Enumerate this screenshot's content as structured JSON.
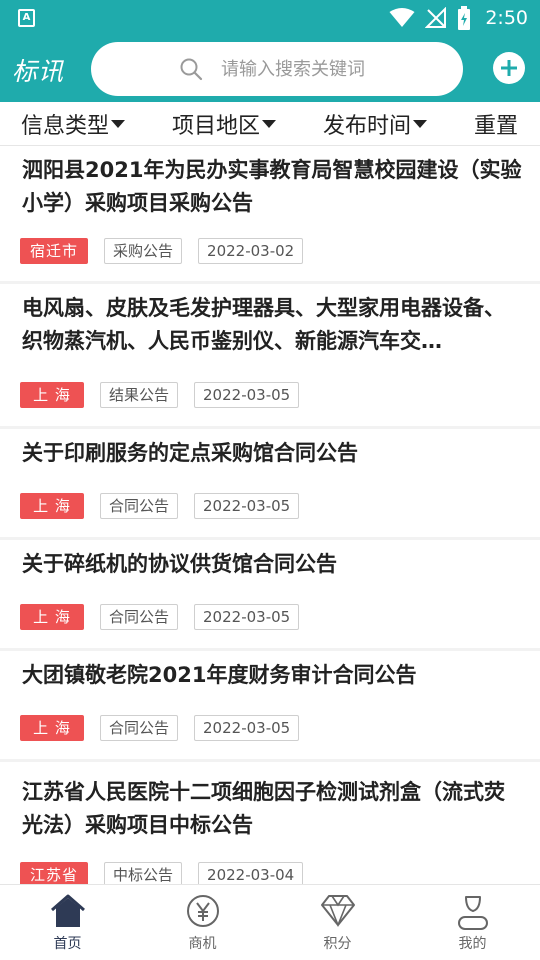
{
  "status_bar": {
    "time": "2:50",
    "app_indicator": "A"
  },
  "header": {
    "logo": "标讯",
    "search_placeholder": "请输入搜索关键词",
    "add_icon": "plus-icon"
  },
  "filters": [
    {
      "label": "信息类型",
      "has_caret": true
    },
    {
      "label": "项目地区",
      "has_caret": true
    },
    {
      "label": "发布时间",
      "has_caret": true
    },
    {
      "label": "重置",
      "has_caret": false
    }
  ],
  "items": [
    {
      "title": "泗阳县2021年为民办实事教育局智慧校园建设（实验小学）采购项目采购公告",
      "region": "宿迁市",
      "type": "采购公告",
      "date": "2022-03-02"
    },
    {
      "title": "电风扇、皮肤及毛发护理器具、大型家用电器设备、织物蒸汽机、人民币鉴别仪、新能源汽车交…",
      "region": "上 海",
      "type": "结果公告",
      "date": "2022-03-05"
    },
    {
      "title": "关于印刷服务的定点采购馆合同公告",
      "region": "上 海",
      "type": "合同公告",
      "date": "2022-03-05"
    },
    {
      "title": "关于碎纸机的协议供货馆合同公告",
      "region": "上 海",
      "type": "合同公告",
      "date": "2022-03-05"
    },
    {
      "title": "大团镇敬老院2021年度财务审计合同公告",
      "region": "上 海",
      "type": "合同公告",
      "date": "2022-03-05"
    },
    {
      "title": "江苏省人民医院十二项细胞因子检测试剂盒（流式荧光法）采购项目中标公告",
      "region": "江苏省",
      "type": "中标公告",
      "date": "2022-03-04"
    }
  ],
  "bottom_nav": [
    {
      "label": "首页",
      "icon": "home-icon",
      "active": true
    },
    {
      "label": "商机",
      "icon": "yen-icon",
      "active": false
    },
    {
      "label": "积分",
      "icon": "diamond-icon",
      "active": false
    },
    {
      "label": "我的",
      "icon": "user-icon",
      "active": false
    }
  ],
  "colors": {
    "primary": "#1fabac",
    "region_tag": "#ee5253",
    "nav_active": "#2e3a55"
  }
}
